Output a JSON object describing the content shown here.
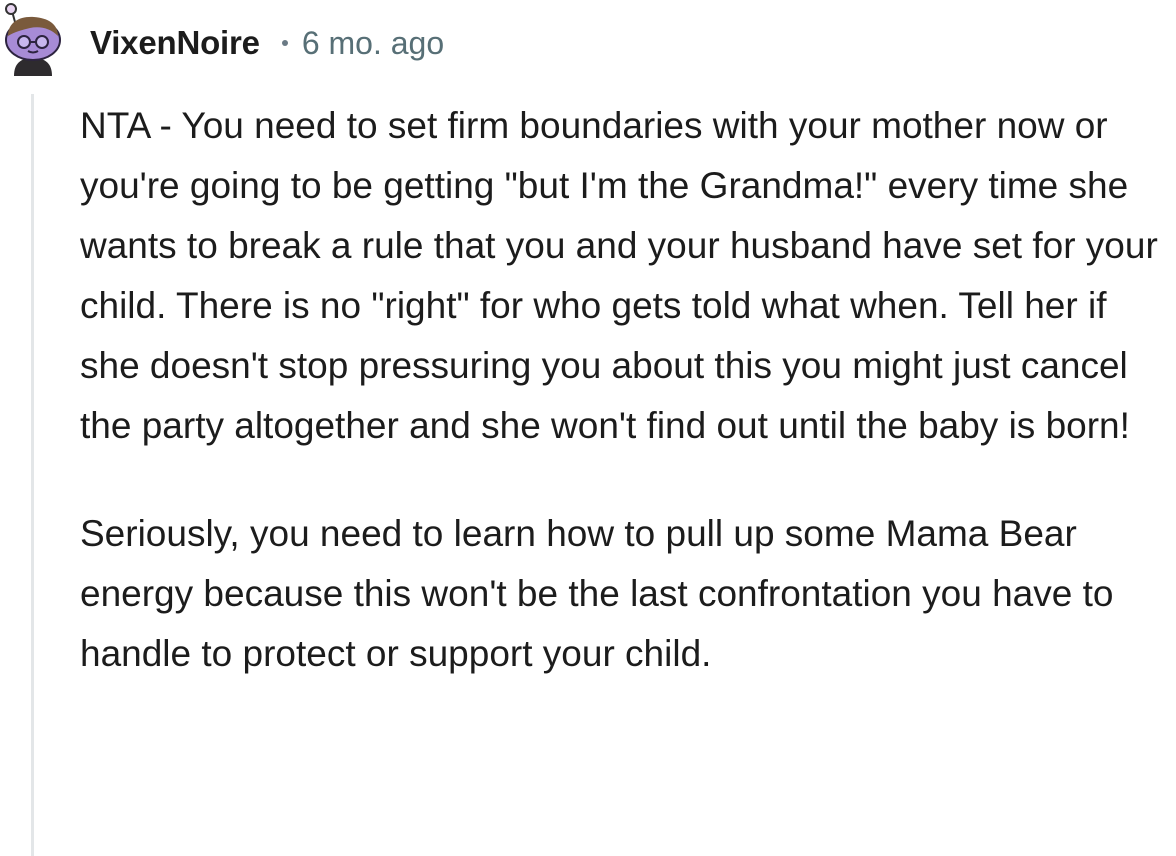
{
  "comment": {
    "author": "VixenNoire",
    "timestamp": "6 mo. ago",
    "paragraphs": [
      "NTA - You need to set firm boundaries with your mother now or you're going to be getting \"but I'm the Grandma!\" every time she wants to break a rule that you and your husband have set for your child. There is no \"right\" for who gets told what when. Tell her if she doesn't stop pressuring you about this you might just cancel the party altogether and she won't find out until the baby is born!",
      "Seriously, you need to learn how to pull up some Mama Bear energy because this won't be the last confrontation you have to handle to protect or support your child."
    ]
  },
  "colors": {
    "username": "#1c1c1c",
    "timestamp": "#576f76",
    "thread_line": "#e3e6e8",
    "avatar_face": "#a78bd6"
  },
  "icons": {
    "avatar": "snoo-avatar-icon",
    "separator": "dot-separator-icon"
  }
}
